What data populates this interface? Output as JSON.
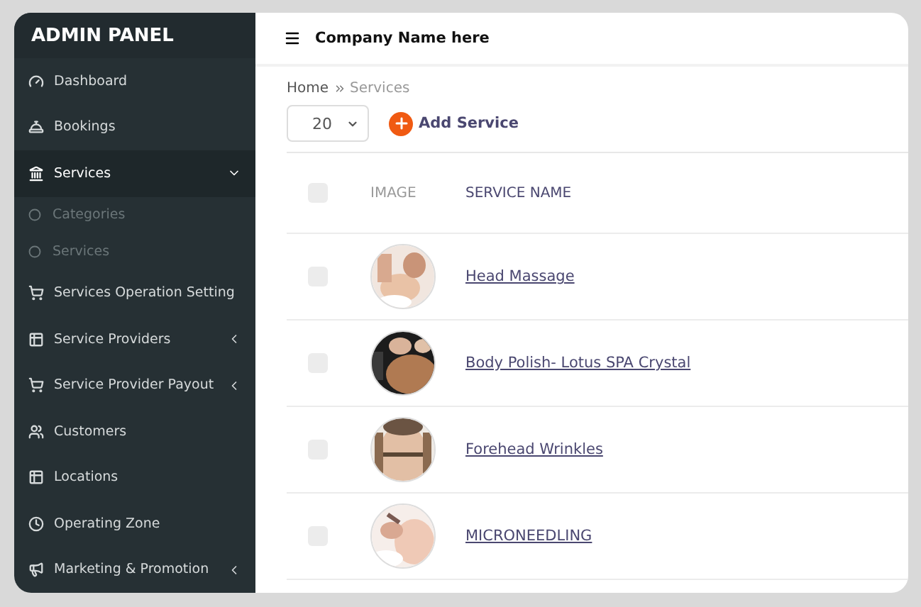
{
  "sidebar": {
    "title": "ADMIN PANEL",
    "items": [
      {
        "label": "Dashboard",
        "kind": "item",
        "selected": false
      },
      {
        "label": "Bookings",
        "kind": "item",
        "selected": false
      },
      {
        "label": "Services",
        "kind": "expanded",
        "selected": true,
        "children": [
          {
            "label": "Categories",
            "selected": false
          },
          {
            "label": "Services",
            "selected": false
          }
        ]
      },
      {
        "label": "Services Operation Setting",
        "kind": "item",
        "selected": false
      },
      {
        "label": "Service Providers",
        "kind": "collapsed",
        "selected": false
      },
      {
        "label": "Service Provider Payout",
        "kind": "collapsed",
        "selected": false
      },
      {
        "label": "Customers",
        "kind": "item",
        "selected": false
      },
      {
        "label": "Locations",
        "kind": "item",
        "selected": false
      },
      {
        "label": "Operating Zone",
        "kind": "item",
        "selected": false
      },
      {
        "label": "Marketing & Promotion",
        "kind": "collapsed",
        "selected": false
      }
    ]
  },
  "header": {
    "title": "Company Name here"
  },
  "breadcrumb": [
    "Home",
    "Services"
  ],
  "page_size": "20",
  "add_button": "Add Service",
  "table": {
    "columns": [
      "IMAGE",
      "SERVICE NAME"
    ],
    "select_all_checked": false,
    "rows": [
      {
        "name": "Head Massage",
        "checked": false
      },
      {
        "name": "Body Polish- Lotus SPA Crystal",
        "checked": false
      },
      {
        "name": "Forehead Wrinkles",
        "checked": false
      },
      {
        "name": "MICRONEEDLING",
        "checked": false
      }
    ]
  }
}
